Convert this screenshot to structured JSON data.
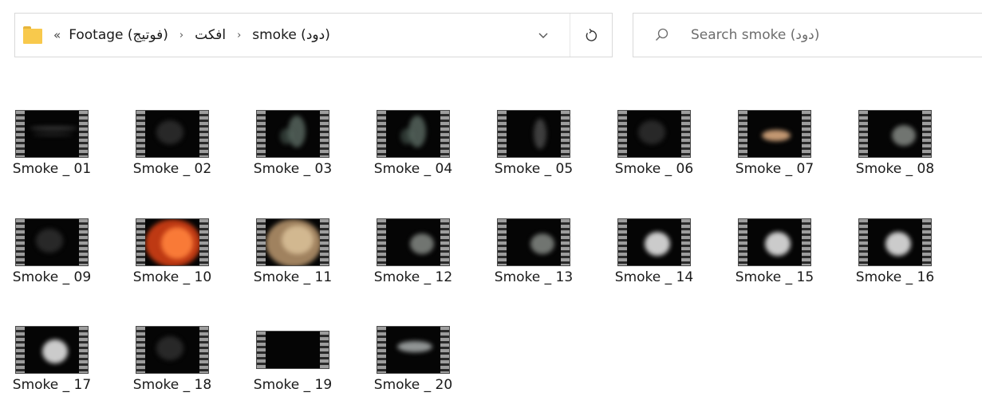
{
  "addressbar": {
    "overflow_chevron": "«",
    "crumbs": [
      "Footage (فوتیج)",
      "افکت",
      "smoke (دود)"
    ],
    "separator": "›",
    "dropdown_glyph": "⌄",
    "refresh_glyph": "↻"
  },
  "search": {
    "placeholder": "Search smoke (دود)"
  },
  "files": [
    {
      "name": "Smoke _ 01",
      "thumb": "faint-lines"
    },
    {
      "name": "Smoke _ 02",
      "thumb": "dark-haze"
    },
    {
      "name": "Smoke _ 03",
      "thumb": "wisp-green"
    },
    {
      "name": "Smoke _ 04",
      "thumb": "wisp-green"
    },
    {
      "name": "Smoke _ 05",
      "thumb": "wisp"
    },
    {
      "name": "Smoke _ 06",
      "thumb": "dark-haze"
    },
    {
      "name": "Smoke _ 07",
      "thumb": "tan-puff"
    },
    {
      "name": "Smoke _ 08",
      "thumb": "grey-puff"
    },
    {
      "name": "Smoke _ 09",
      "thumb": "dark-haze"
    },
    {
      "name": "Smoke _ 10",
      "thumb": "fire"
    },
    {
      "name": "Smoke _ 11",
      "thumb": "tan-cloud"
    },
    {
      "name": "Smoke _ 12",
      "thumb": "grey-puff"
    },
    {
      "name": "Smoke _ 13",
      "thumb": "grey-puff"
    },
    {
      "name": "Smoke _ 14",
      "thumb": "white-puff"
    },
    {
      "name": "Smoke _ 15",
      "thumb": "white-puff"
    },
    {
      "name": "Smoke _ 16",
      "thumb": "white-puff"
    },
    {
      "name": "Smoke _ 17",
      "thumb": "white-puff"
    },
    {
      "name": "Smoke _ 18",
      "thumb": "dark-haze"
    },
    {
      "name": "Smoke _ 19",
      "thumb": "black"
    },
    {
      "name": "Smoke _ 20",
      "thumb": "grey-streak"
    }
  ],
  "colors": {
    "folder": "#f8c94c",
    "text": "#1a1a1a",
    "border": "#d9d9d9"
  }
}
